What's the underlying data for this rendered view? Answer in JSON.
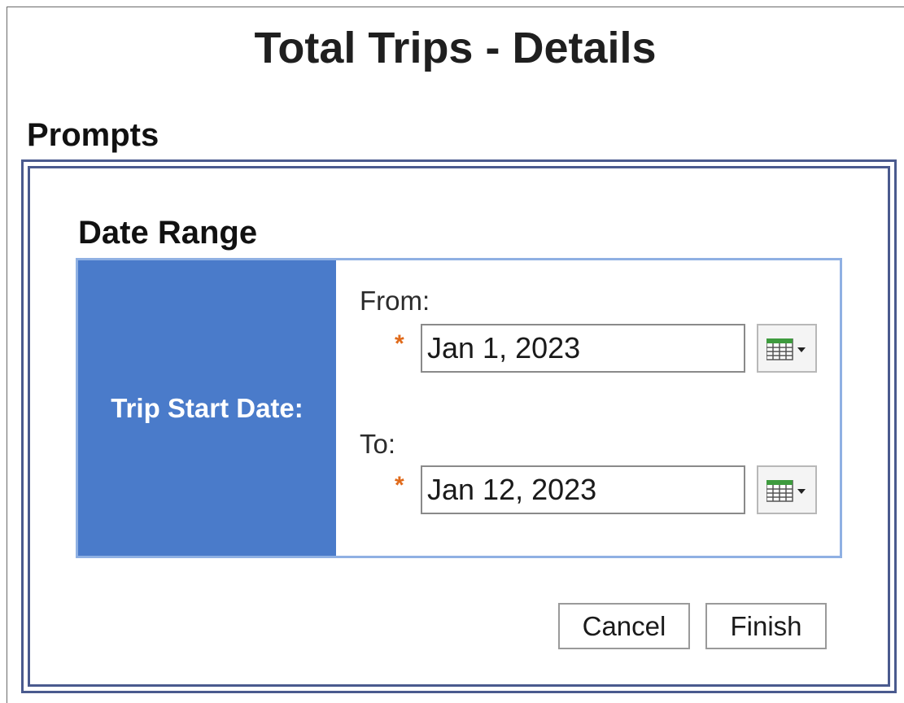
{
  "page": {
    "title": "Total Trips - Details"
  },
  "prompts": {
    "section_title": "Prompts",
    "date_range": {
      "group_title": "Date Range",
      "field_label": "Trip Start Date:",
      "from": {
        "label": "From:",
        "value": "Jan 1, 2023",
        "required_mark": "*"
      },
      "to": {
        "label": "To:",
        "value": "Jan 12, 2023",
        "required_mark": "*"
      },
      "calendar_icon": "calendar-dropdown-icon"
    },
    "actions": {
      "cancel_label": "Cancel",
      "finish_label": "Finish"
    }
  },
  "colors": {
    "label_cell_bg": "#4a7bca",
    "panel_border": "#8fb0e3",
    "prompt_border": "#4a5a8e",
    "required_mark": "#e06a1a"
  }
}
